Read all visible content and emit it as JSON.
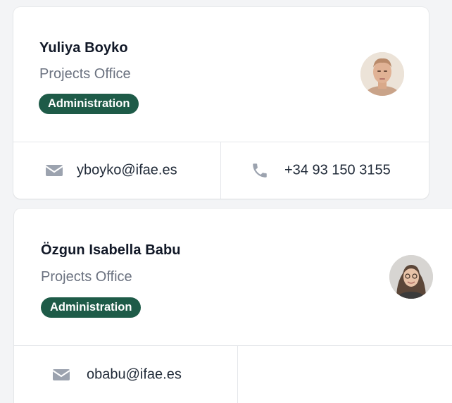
{
  "contacts": [
    {
      "name": "Yuliya Boyko",
      "office": "Projects Office",
      "department": "Administration",
      "email": "yboyko@ifae.es",
      "phone": "+34 93 150 3155",
      "avatar_icon": "person-photo-icon"
    },
    {
      "name": "Özgun Isabella Babu",
      "office": "Projects Office",
      "department": "Administration",
      "email": "obabu@ifae.es",
      "phone": "",
      "avatar_icon": "person-photo-icon"
    }
  ],
  "colors": {
    "badge_bg": "#1e5b48",
    "muted_text": "#6b7280",
    "icon": "#9ca3af",
    "card_bg": "#ffffff",
    "page_bg": "#f3f4f6"
  },
  "icons": {
    "email": "mail-icon",
    "phone": "phone-icon"
  }
}
